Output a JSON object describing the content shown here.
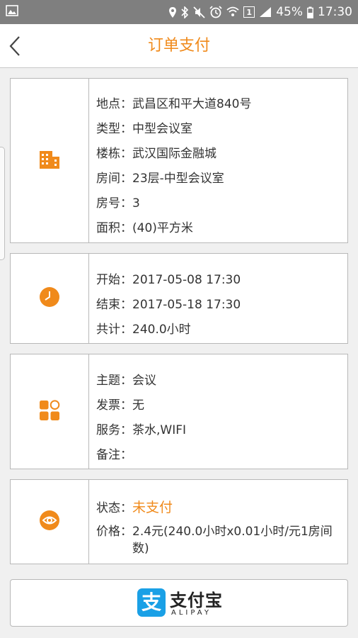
{
  "status_bar": {
    "battery": "45%",
    "time": "17:30",
    "sim_badge": "1"
  },
  "nav": {
    "title": "订单支付"
  },
  "location_card": {
    "icon": "building-icon",
    "rows": [
      {
        "label": "地点：",
        "value": "武昌区和平大道840号"
      },
      {
        "label": "类型：",
        "value": "中型会议室"
      },
      {
        "label": "楼栋：",
        "value": "武汉国际金融城"
      },
      {
        "label": "房间：",
        "value": "23层-中型会议室"
      },
      {
        "label": "房号：",
        "value": "3"
      },
      {
        "label": "面积：",
        "value": "(40)平方米"
      }
    ]
  },
  "time_card": {
    "icon": "clock-icon",
    "rows": [
      {
        "label": "开始：",
        "value": "2017-05-08 17:30"
      },
      {
        "label": "结束：",
        "value": "2017-05-18 17:30"
      },
      {
        "label": "共计：",
        "value": "240.0小时"
      }
    ]
  },
  "detail_card": {
    "icon": "apps-icon",
    "rows": [
      {
        "label": "主题：",
        "value": "会议"
      },
      {
        "label": "发票：",
        "value": "无"
      },
      {
        "label": "服务：",
        "value": "茶水,WIFI"
      },
      {
        "label": "备注：",
        "value": ""
      }
    ]
  },
  "status_card": {
    "icon": "eye-icon",
    "status_label": "状态：",
    "status_value": "未支付",
    "price_label": "价格：",
    "price_value": "2.4元(240.0小时x0.01小时/元1房间数)"
  },
  "alipay": {
    "logo_glyph": "支",
    "name_cn": "支付宝",
    "name_en": "ALIPAY"
  },
  "colors": {
    "accent": "#f08a1b",
    "alipay_blue": "#1aa0e6",
    "status_bar": "#7f7f7f"
  }
}
